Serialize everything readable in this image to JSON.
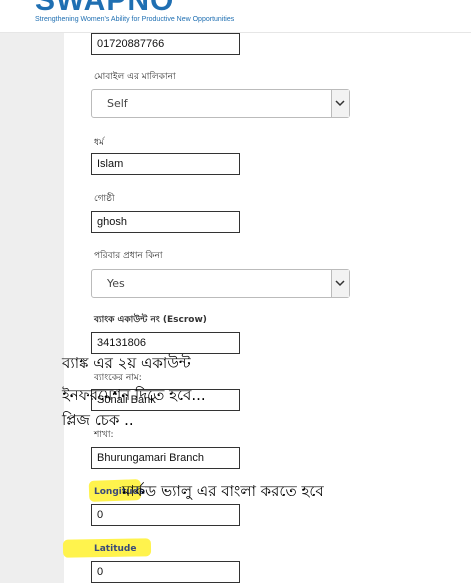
{
  "header": {
    "logo": "SWAPNO",
    "tagline": "Strengthening Women's Ability for Productive New Opportunities"
  },
  "form": {
    "mobile_value": "01720887766",
    "mobile_owner_label": "মোবাইল এর মালিকানা",
    "mobile_owner_value": "Self",
    "religion_label": "ধর্ম",
    "religion_value": "Islam",
    "clan_label": "গোষ্ঠী",
    "clan_value": "ghosh",
    "household_head_label": "পরিবার প্রধান কিনা",
    "household_head_value": "Yes",
    "bank_account_label": "ব্যাংক একাউন্ট নং (Escrow)",
    "bank_account_value": "34131806",
    "bank_name_label": "ব্যাংকের নাম:",
    "bank_name_value": "Sonali Bank",
    "branch_label": "শাখা:",
    "branch_value": "Bhurungamari Branch",
    "longitude_label": "Longitude",
    "longitude_value": "0",
    "latitude_label": "Latitude",
    "latitude_value": "0"
  },
  "annotations": {
    "note1_line1": "ব্যাঙ্ক এর ২য় একাউন্ট",
    "note1_line2": "ইনফরমেশন দিতে হবে...",
    "note1_line3": "প্লিজ চেক ..",
    "note2": "মার্কড ভ্যালু এর বাংলা করতে হবে"
  },
  "colors": {
    "brand": "#1f6fb2",
    "highlight": "#fff34d"
  }
}
